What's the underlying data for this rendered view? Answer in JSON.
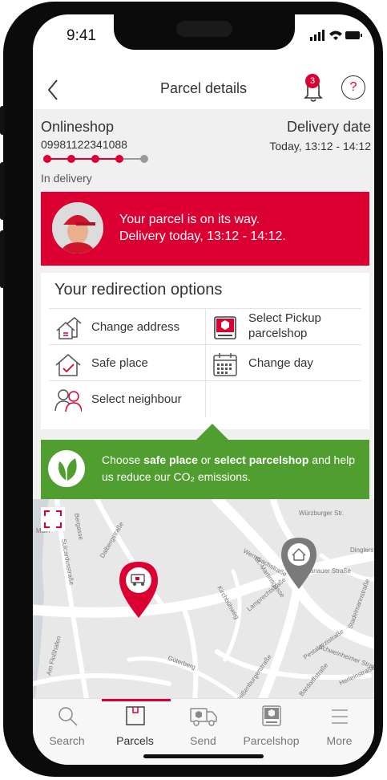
{
  "status_bar": {
    "time": "9:41"
  },
  "header": {
    "title": "Parcel details",
    "notification_count": "3",
    "help_label": "?"
  },
  "parcel": {
    "shop": "Onlineshop",
    "number": "09981122341088",
    "delivery_date_label": "Delivery date",
    "delivery_time": "Today, 13:12 - 14:12",
    "status": "In delivery",
    "progress_steps_total": 5,
    "progress_steps_done": 4
  },
  "banner": {
    "line1": "Your parcel is on its way.",
    "line2": "Delivery today, 13:12 - 14:12."
  },
  "redirection": {
    "title": "Your redirection options",
    "options": [
      {
        "label": "Change address",
        "icon": "change-address-icon"
      },
      {
        "label": "Select Pickup parcelshop",
        "icon": "pickup-parcelshop-icon"
      },
      {
        "label": "Safe place",
        "icon": "safe-place-icon"
      },
      {
        "label": "Change day",
        "icon": "calendar-icon"
      },
      {
        "label": "Select neighbour",
        "icon": "neighbour-icon"
      }
    ]
  },
  "eco": {
    "prefix": "Choose ",
    "bold1": "safe place",
    "middle": " or ",
    "bold2": "select parcelshop",
    "suffix": " and help us reduce our CO₂ emissions."
  },
  "map": {
    "streets": [
      "Würzburger Str.",
      "Wermbachstraße",
      "Bergasse",
      "Dinglerstr.",
      "Lamprechtstraße",
      "Kirchbühweg",
      "Güterberg",
      "Pestalozzistraße",
      "Schweinheimer Straße",
      "Hanauer Straße",
      "Am Floßhafen",
      "Main",
      "Suicardusstraße",
      "Dalbergstraße",
      "Stadelmannstraße",
      "St.-Martinsgasse",
      "Herleinstraße",
      "Bardorffstraße",
      "Weißenburgerstraße"
    ]
  },
  "tabs": [
    {
      "label": "Search",
      "icon": "search-icon"
    },
    {
      "label": "Parcels",
      "icon": "parcels-icon",
      "active": true
    },
    {
      "label": "Send",
      "icon": "send-icon"
    },
    {
      "label": "Parcelshop",
      "icon": "parcelshop-icon"
    },
    {
      "label": "More",
      "icon": "menu-icon"
    }
  ],
  "colors": {
    "brand_red": "#dc0032",
    "eco_green": "#509e2f"
  }
}
